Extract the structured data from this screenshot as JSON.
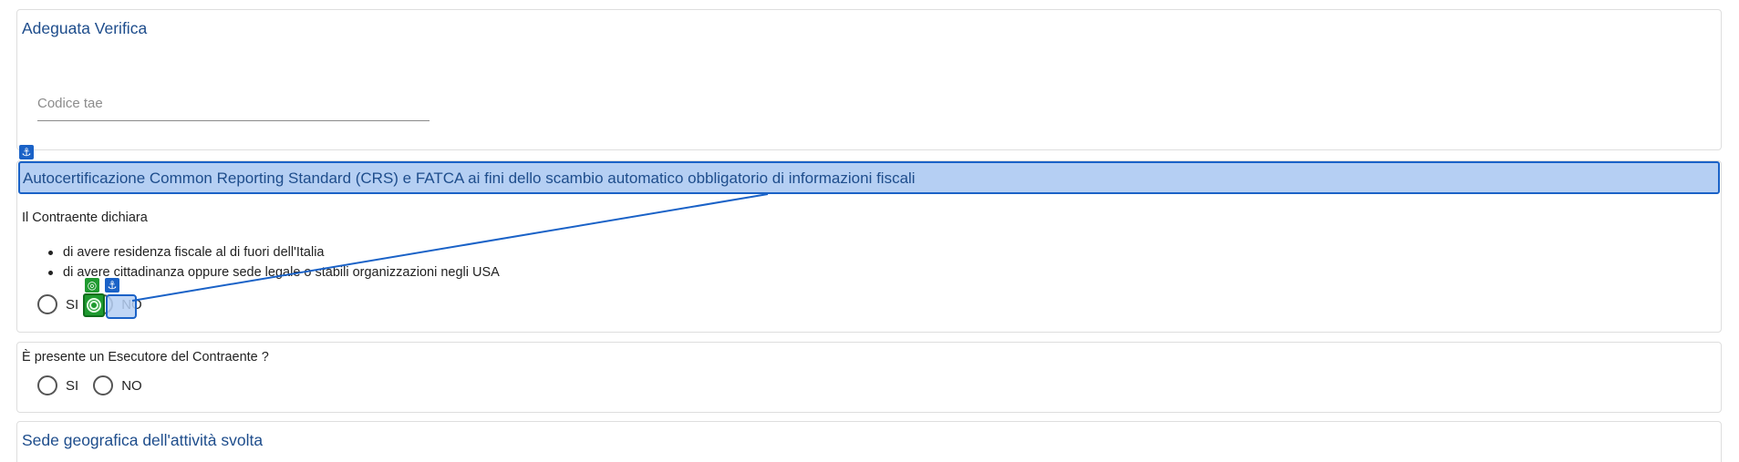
{
  "adeguata": {
    "title": "Adeguata Verifica",
    "tae_placeholder": "Codice tae",
    "tae_value": ""
  },
  "crs": {
    "title": "Autocertificazione Common Reporting Standard (CRS) e FATCA ai fini dello scambio automatico obbligatorio di informazioni fiscali",
    "declares": "Il Contraente dichiara",
    "bullets": [
      "di avere residenza fiscale al di fuori dell'Italia",
      "di avere cittadinanza oppure sede legale o stabili organizzazioni negli USA"
    ],
    "option_yes": "SI",
    "option_no": "NO"
  },
  "esecutore": {
    "question": "È presente un Esecutore del Contraente ?",
    "option_yes": "SI",
    "option_no": "NO"
  },
  "sede": {
    "title": "Sede geografica dell'attività svolta"
  },
  "overlay": {
    "anchor_glyph": "⚓",
    "target_glyph": "◎",
    "highlight_color": "#b5cff3",
    "link_color": "#1a62c7",
    "target_color": "#1f9a30"
  }
}
